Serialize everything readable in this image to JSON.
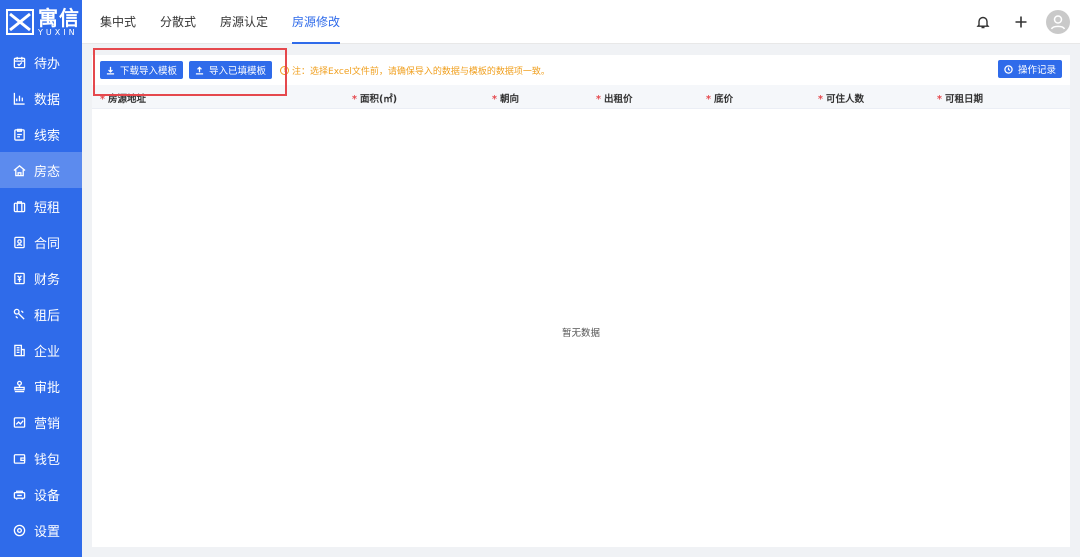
{
  "brand": {
    "name_cn": "寓信",
    "name_en": "YUXIN"
  },
  "sidebar": {
    "items": [
      {
        "label": "待办",
        "icon": "calendar-icon"
      },
      {
        "label": "数据",
        "icon": "bar-chart-icon"
      },
      {
        "label": "线索",
        "icon": "clipboard-icon"
      },
      {
        "label": "房态",
        "icon": "house-icon",
        "active": true
      },
      {
        "label": "短租",
        "icon": "suitcase-icon"
      },
      {
        "label": "合同",
        "icon": "contract-icon"
      },
      {
        "label": "财务",
        "icon": "finance-icon"
      },
      {
        "label": "租后",
        "icon": "wrench-icon"
      },
      {
        "label": "企业",
        "icon": "building-icon"
      },
      {
        "label": "审批",
        "icon": "stamp-icon"
      },
      {
        "label": "营销",
        "icon": "trend-icon"
      },
      {
        "label": "钱包",
        "icon": "wallet-icon"
      },
      {
        "label": "设备",
        "icon": "device-icon"
      },
      {
        "label": "设置",
        "icon": "gear-icon"
      }
    ]
  },
  "header": {
    "tabs": [
      {
        "label": "集中式"
      },
      {
        "label": "分散式"
      },
      {
        "label": "房源认定"
      },
      {
        "label": "房源修改",
        "active": true
      }
    ]
  },
  "toolbar": {
    "download_label": "下载导入模板",
    "import_label": "导入已填模板",
    "note": "注：选择Excel文件前，请确保导入的数据与模板的数据项一致。",
    "log_label": "操作记录"
  },
  "table": {
    "columns": [
      "房源地址",
      "面积(㎡)",
      "朝向",
      "出租价",
      "底价",
      "可住人数",
      "可租日期"
    ],
    "empty_text": "暂无数据"
  },
  "colors": {
    "primary": "#2f6bea",
    "warning": "#f0a020",
    "required": "#e5484d"
  }
}
